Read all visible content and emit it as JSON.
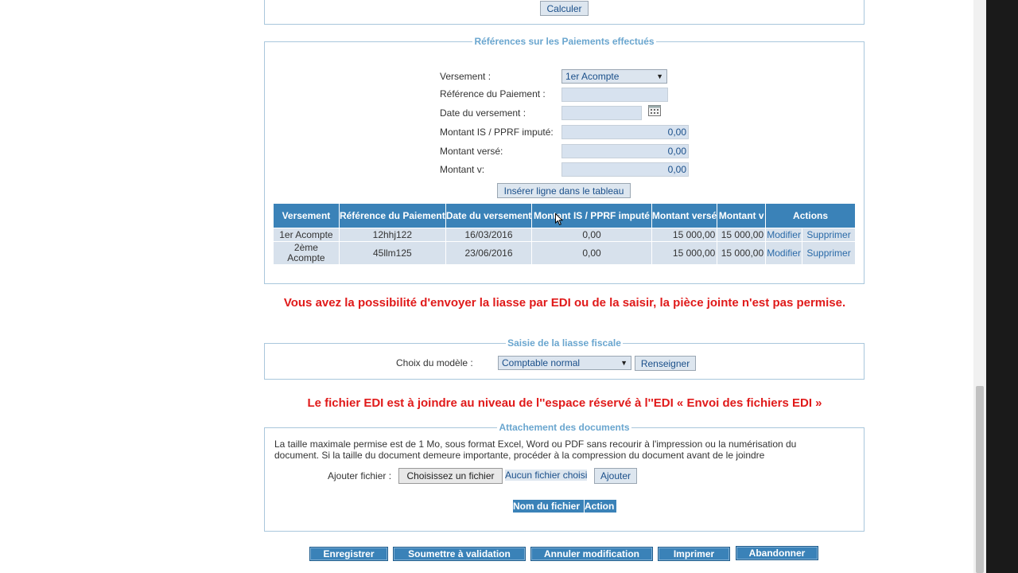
{
  "top": {
    "calculer": "Calculer"
  },
  "paiements": {
    "legend": "Références sur les Paiements effectués",
    "versement_label": "Versement :",
    "versement_value": "1er Acompte",
    "reference_label": "Référence du Paiement :",
    "date_label": "Date du versement :",
    "montant_is_label": "Montant IS / PPRF imputé:",
    "montant_is_value": "0,00",
    "montant_verse_label": "Montant versé:",
    "montant_verse_value": "0,00",
    "montant_v_label": "Montant v:",
    "montant_v_value": "0,00",
    "inserer": "Insérer ligne dans le tableau",
    "headers": [
      "Versement",
      "Référence du Paiement",
      "Date du versement",
      "Montant IS / PPRF imputé",
      "Montant versé",
      "Montant v",
      "Actions"
    ],
    "rows": [
      {
        "versement": "1er Acompte",
        "reference": "12hhj122",
        "date": "16/03/2016",
        "montant_is": "0,00",
        "montant_verse": "15 000,00",
        "montant_v": "15 000,00",
        "modifier": "Modifier",
        "supprimer": "Supprimer"
      },
      {
        "versement": "2ème Acompte",
        "reference": "45llm125",
        "date": "23/06/2016",
        "montant_is": "0,00",
        "montant_verse": "15 000,00",
        "montant_v": "15 000,00",
        "modifier": "Modifier",
        "supprimer": "Supprimer"
      }
    ]
  },
  "messages": {
    "edi_possibility": "Vous avez la possibilité d'envoyer la liasse par EDI ou de la saisir, la pièce jointe n'est pas permise.",
    "edi_file": "Le fichier EDI est à joindre au niveau de l''espace réservé à l''EDI « Envoi des fichiers EDI »"
  },
  "liasse": {
    "legend": "Saisie de la liasse fiscale",
    "modele_label": "Choix du modèle :",
    "modele_value": "Comptable normal",
    "renseigner": "Renseigner"
  },
  "attachement": {
    "legend": "Attachement des documents",
    "info": "La taille maximale permise est de 1 Mo, sous format Excel, Word ou PDF sans recourir à l'impression ou la numérisation du document. Si la taille du document demeure importante, procéder à la compression du document avant de le joindre",
    "ajouter_label": "Ajouter fichier :",
    "choose_button": "Choisissez un fichier",
    "no_file": "Aucun fichier choisi",
    "ajouter_button": "Ajouter",
    "col_nom": "Nom du fichier",
    "col_action": "Action"
  },
  "footer": {
    "enregistrer": "Enregistrer",
    "soumettre": "Soumettre à validation",
    "annuler": "Annuler modification",
    "imprimer": "Imprimer",
    "abandonner": "Abandonner"
  },
  "icons": {
    "calendar": "calendar-icon",
    "dropdown": "chevron-down-icon",
    "cursor": "mouse-cursor-icon"
  },
  "colors": {
    "header_blue": "#3a82b8",
    "row_bg": "#d7e1ec",
    "legend_blue": "#6aa6cf",
    "alert_red": "#e01a1a"
  }
}
